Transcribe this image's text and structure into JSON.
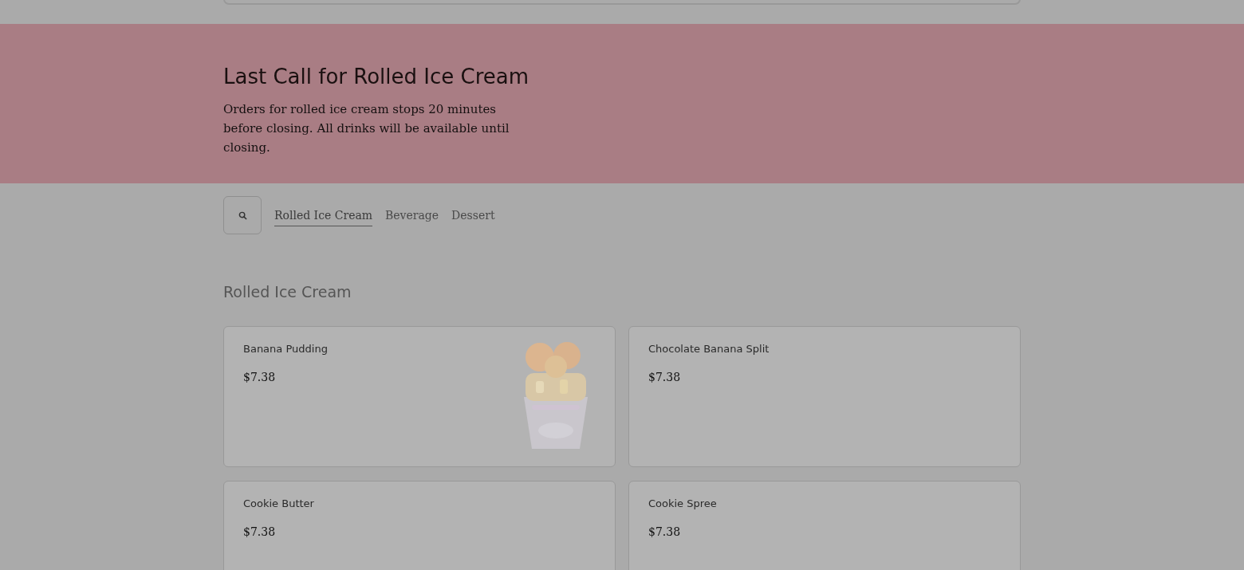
{
  "banner": {
    "title": "Last Call for Rolled Ice Cream",
    "text": "Orders for rolled ice cream stops 20 minutes before closing. All drinks will be available until closing."
  },
  "tabs": [
    {
      "label": "Rolled Ice Cream",
      "selected": true
    },
    {
      "label": "Beverage",
      "selected": false
    },
    {
      "label": "Dessert",
      "selected": false
    }
  ],
  "section": {
    "title": "Rolled Ice Cream",
    "items": [
      {
        "name": "Banana Pudding",
        "price": "$7.38",
        "kind": "picture"
      },
      {
        "name": "Chocolate Banana Split",
        "price": "$7.38"
      },
      {
        "name": "Cookie Butter",
        "price": "$7.38"
      },
      {
        "name": "Cookie Spree",
        "price": "$7.38"
      }
    ]
  }
}
